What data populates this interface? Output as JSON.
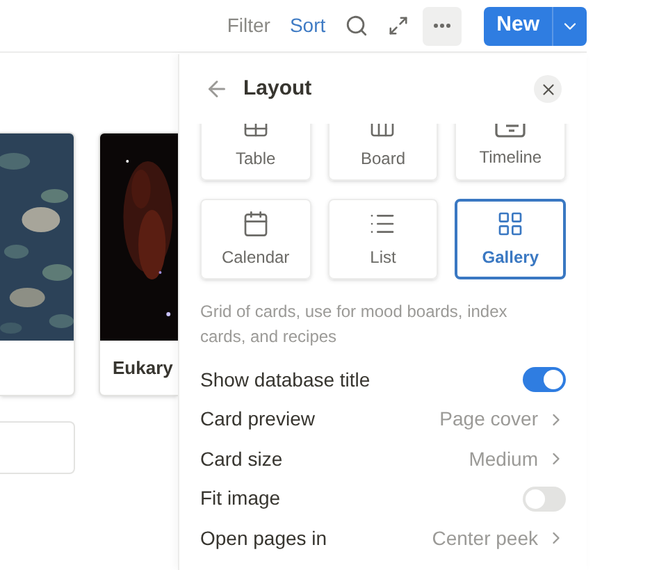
{
  "toolbar": {
    "filter": "Filter",
    "sort": "Sort",
    "new_button": "New"
  },
  "gallery": {
    "cards": [
      {
        "kind": "picture"
      },
      {
        "kind": "picture",
        "title": "Eukary"
      }
    ]
  },
  "panel": {
    "title": "Layout",
    "layouts": [
      {
        "label": "Table",
        "selected": false
      },
      {
        "label": "Board",
        "selected": false
      },
      {
        "label": "Timeline",
        "selected": false
      },
      {
        "label": "Calendar",
        "selected": false
      },
      {
        "label": "List",
        "selected": false
      },
      {
        "label": "Gallery",
        "selected": true
      }
    ],
    "description": "Grid of cards, use for mood boards, index cards, and recipes",
    "settings": [
      {
        "kind": "toggle",
        "label": "Show database title",
        "on": true
      },
      {
        "kind": "select",
        "label": "Card preview",
        "value": "Page cover"
      },
      {
        "kind": "select",
        "label": "Card size",
        "value": "Medium"
      },
      {
        "kind": "toggle",
        "label": "Fit image",
        "on": false
      },
      {
        "kind": "select",
        "label": "Open pages in",
        "value": "Center peek"
      }
    ]
  }
}
